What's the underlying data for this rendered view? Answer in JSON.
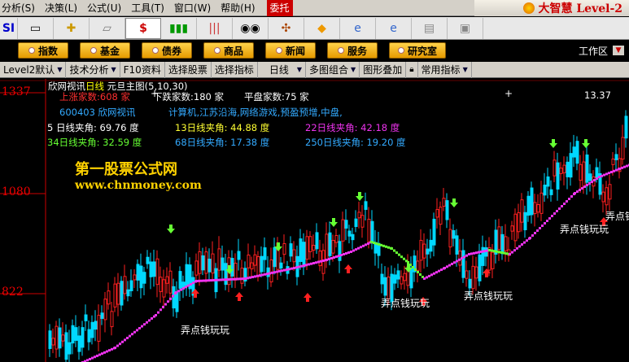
{
  "menu": {
    "items": [
      "分析(S)",
      "决策(L)",
      "公式(U)",
      "工具(T)",
      "窗口(W)",
      "帮助(H)"
    ],
    "commission": "委托",
    "logo": "大智慧 Level-2"
  },
  "toolbar": {
    "icons": [
      "si-icon",
      "monitor-icon",
      "crosshair-icon",
      "ruler-icon",
      "dollar-icon",
      "candle-icon",
      "bars-icon",
      "binoculars-icon",
      "network-icon",
      "diamond-icon",
      "ie-icon",
      "ie2-icon",
      "doc-icon",
      "window-icon"
    ]
  },
  "fnbar": {
    "buttons": [
      "指数",
      "基金",
      "债券",
      "商品",
      "新闻",
      "服务",
      "研究室"
    ],
    "workarea": "工作区"
  },
  "tabs": [
    "Level2默认",
    "技术分析",
    "F10资料",
    "选择股票",
    "选择指标",
    "日线",
    "多图组合",
    "图形叠加",
    "常用指标"
  ],
  "chart": {
    "title": "欣网视讯",
    "period": "日线",
    "main_indicator": "元旦主图(5,10,30)",
    "up_count": "上涨家数:608 家",
    "down_count": "下跌家数:180 家",
    "flat_count": "平盘家数:75 家",
    "code_name": "600403 欣网视讯",
    "concepts": "计算机,江苏沿海,网络游戏,预盈预增,中盘,",
    "angle_5": "5 日线夹角: 69.76 度",
    "angle_13": "13日线夹角: 44.88 度",
    "angle_22": "22日线夹角: 42.18 度",
    "angle_34": "34日线夹角: 32.59 度",
    "angle_68": "68日线夹角: 17.38 度",
    "angle_250": "250日线夹角: 19.20 度",
    "y_high": "1337",
    "y_mid": "1080",
    "y_low": "822",
    "last_price": "13.37",
    "brand": "第一股票公式网",
    "brand_url": "www.chnmoney.com",
    "signal": "弄点钱玩玩",
    "colors": {
      "up": "#ff2020",
      "down": "#00d8ff",
      "ma_up": "#66ff33",
      "ma_down": "#ee33ee",
      "buy": "#ff2020",
      "sell": "#66ff33"
    }
  }
}
